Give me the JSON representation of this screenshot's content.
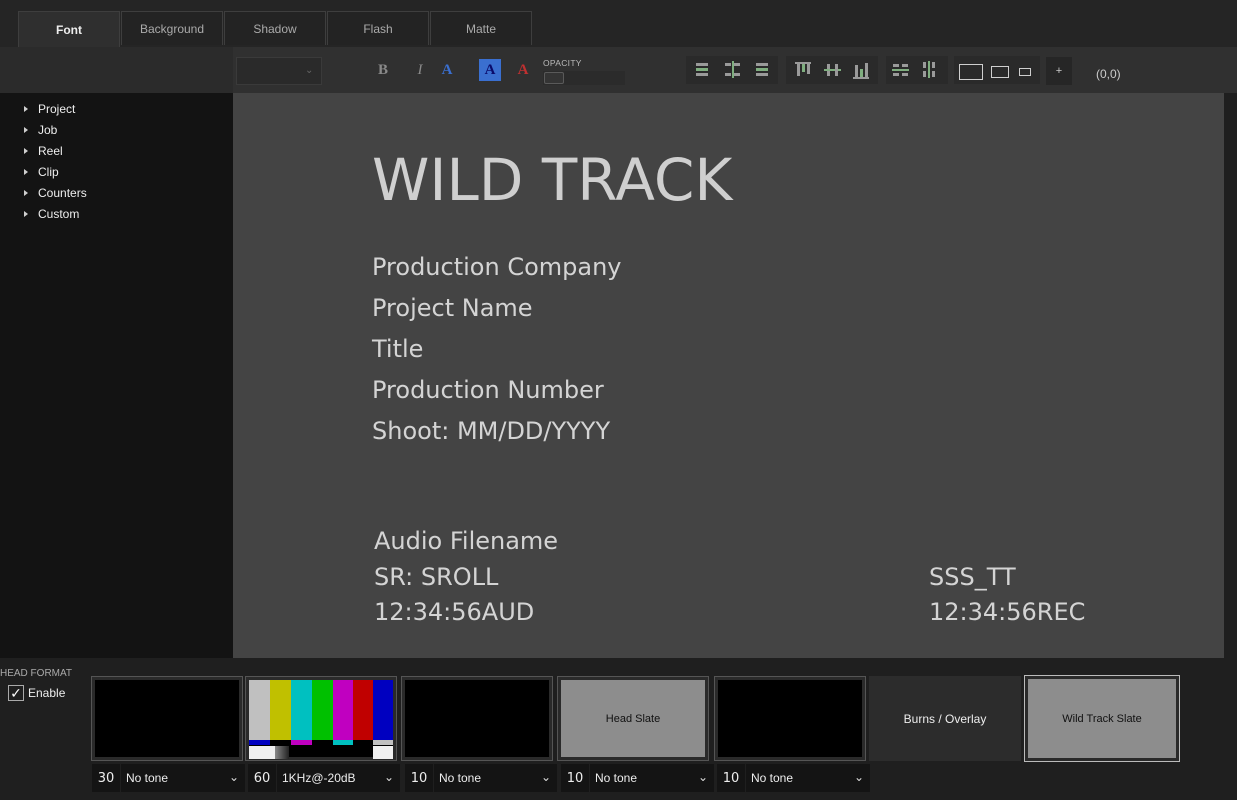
{
  "tabs": [
    {
      "label": "Font",
      "active": true
    },
    {
      "label": "Background",
      "active": false
    },
    {
      "label": "Shadow",
      "active": false
    },
    {
      "label": "Flash",
      "active": false
    },
    {
      "label": "Matte",
      "active": false
    }
  ],
  "toolbar": {
    "font_select_value": "",
    "bold": "B",
    "italic": "I",
    "text_style_a": "A",
    "opacity_label": "OPACITY",
    "opacity_value": 0,
    "add_label": "+",
    "coordinates": "(0,0)",
    "align_icons": [
      "align-left-icon",
      "align-center-h-icon",
      "align-right-icon",
      "align-top-icon",
      "align-center-v-icon",
      "align-bottom-icon",
      "distribute-h-icon",
      "distribute-v-icon"
    ],
    "size_icons": [
      "box-large-icon",
      "box-medium-icon",
      "box-small-icon"
    ]
  },
  "tree": {
    "items": [
      "Project",
      "Job",
      "Reel",
      "Clip",
      "Counters",
      "Custom"
    ]
  },
  "canvas": {
    "title": "WILD TRACK",
    "line1": "Production Company",
    "line2": "Project Name",
    "line3": "Title",
    "line4": "Production Number",
    "line5": "Shoot: MM/DD/YYYY",
    "audio_filename": "Audio Filename",
    "sr_roll": "SR: SROLL",
    "aud_tc": "12:34:56AUD",
    "sss_tt": "SSS_TT",
    "rec_tc": "12:34:56REC"
  },
  "bottom": {
    "head_format_label": "HEAD FORMAT",
    "enable_label": "Enable",
    "enable_checked": true,
    "check_glyph": "✓",
    "thumbnails": [
      {
        "label": "",
        "kind": "black"
      },
      {
        "label": "",
        "kind": "color-bars"
      },
      {
        "label": "",
        "kind": "black"
      },
      {
        "label": "Head Slate",
        "kind": "gray"
      },
      {
        "label": "",
        "kind": "black"
      },
      {
        "label": "Burns / Overlay",
        "kind": "dark"
      },
      {
        "label": "Wild Track Slate",
        "kind": "gray-selected"
      }
    ],
    "segments": [
      {
        "duration": "30",
        "tone": "No tone"
      },
      {
        "duration": "60",
        "tone": "1KHz@-20dB"
      },
      {
        "duration": "10",
        "tone": "No tone"
      },
      {
        "duration": "10",
        "tone": "No tone"
      },
      {
        "duration": "10",
        "tone": "No tone"
      }
    ],
    "dropdown_glyph": "⌄"
  },
  "colors": {
    "canvas_bg": "#444444",
    "sidebar_bg": "#131313",
    "accent_blue": "#3a6fd0",
    "align_icon_accent": "#7fae7f",
    "bars": [
      "#c0c0c0",
      "#c0c000",
      "#00c0c0",
      "#00c000",
      "#c000c0",
      "#c00000",
      "#0000c0"
    ]
  }
}
